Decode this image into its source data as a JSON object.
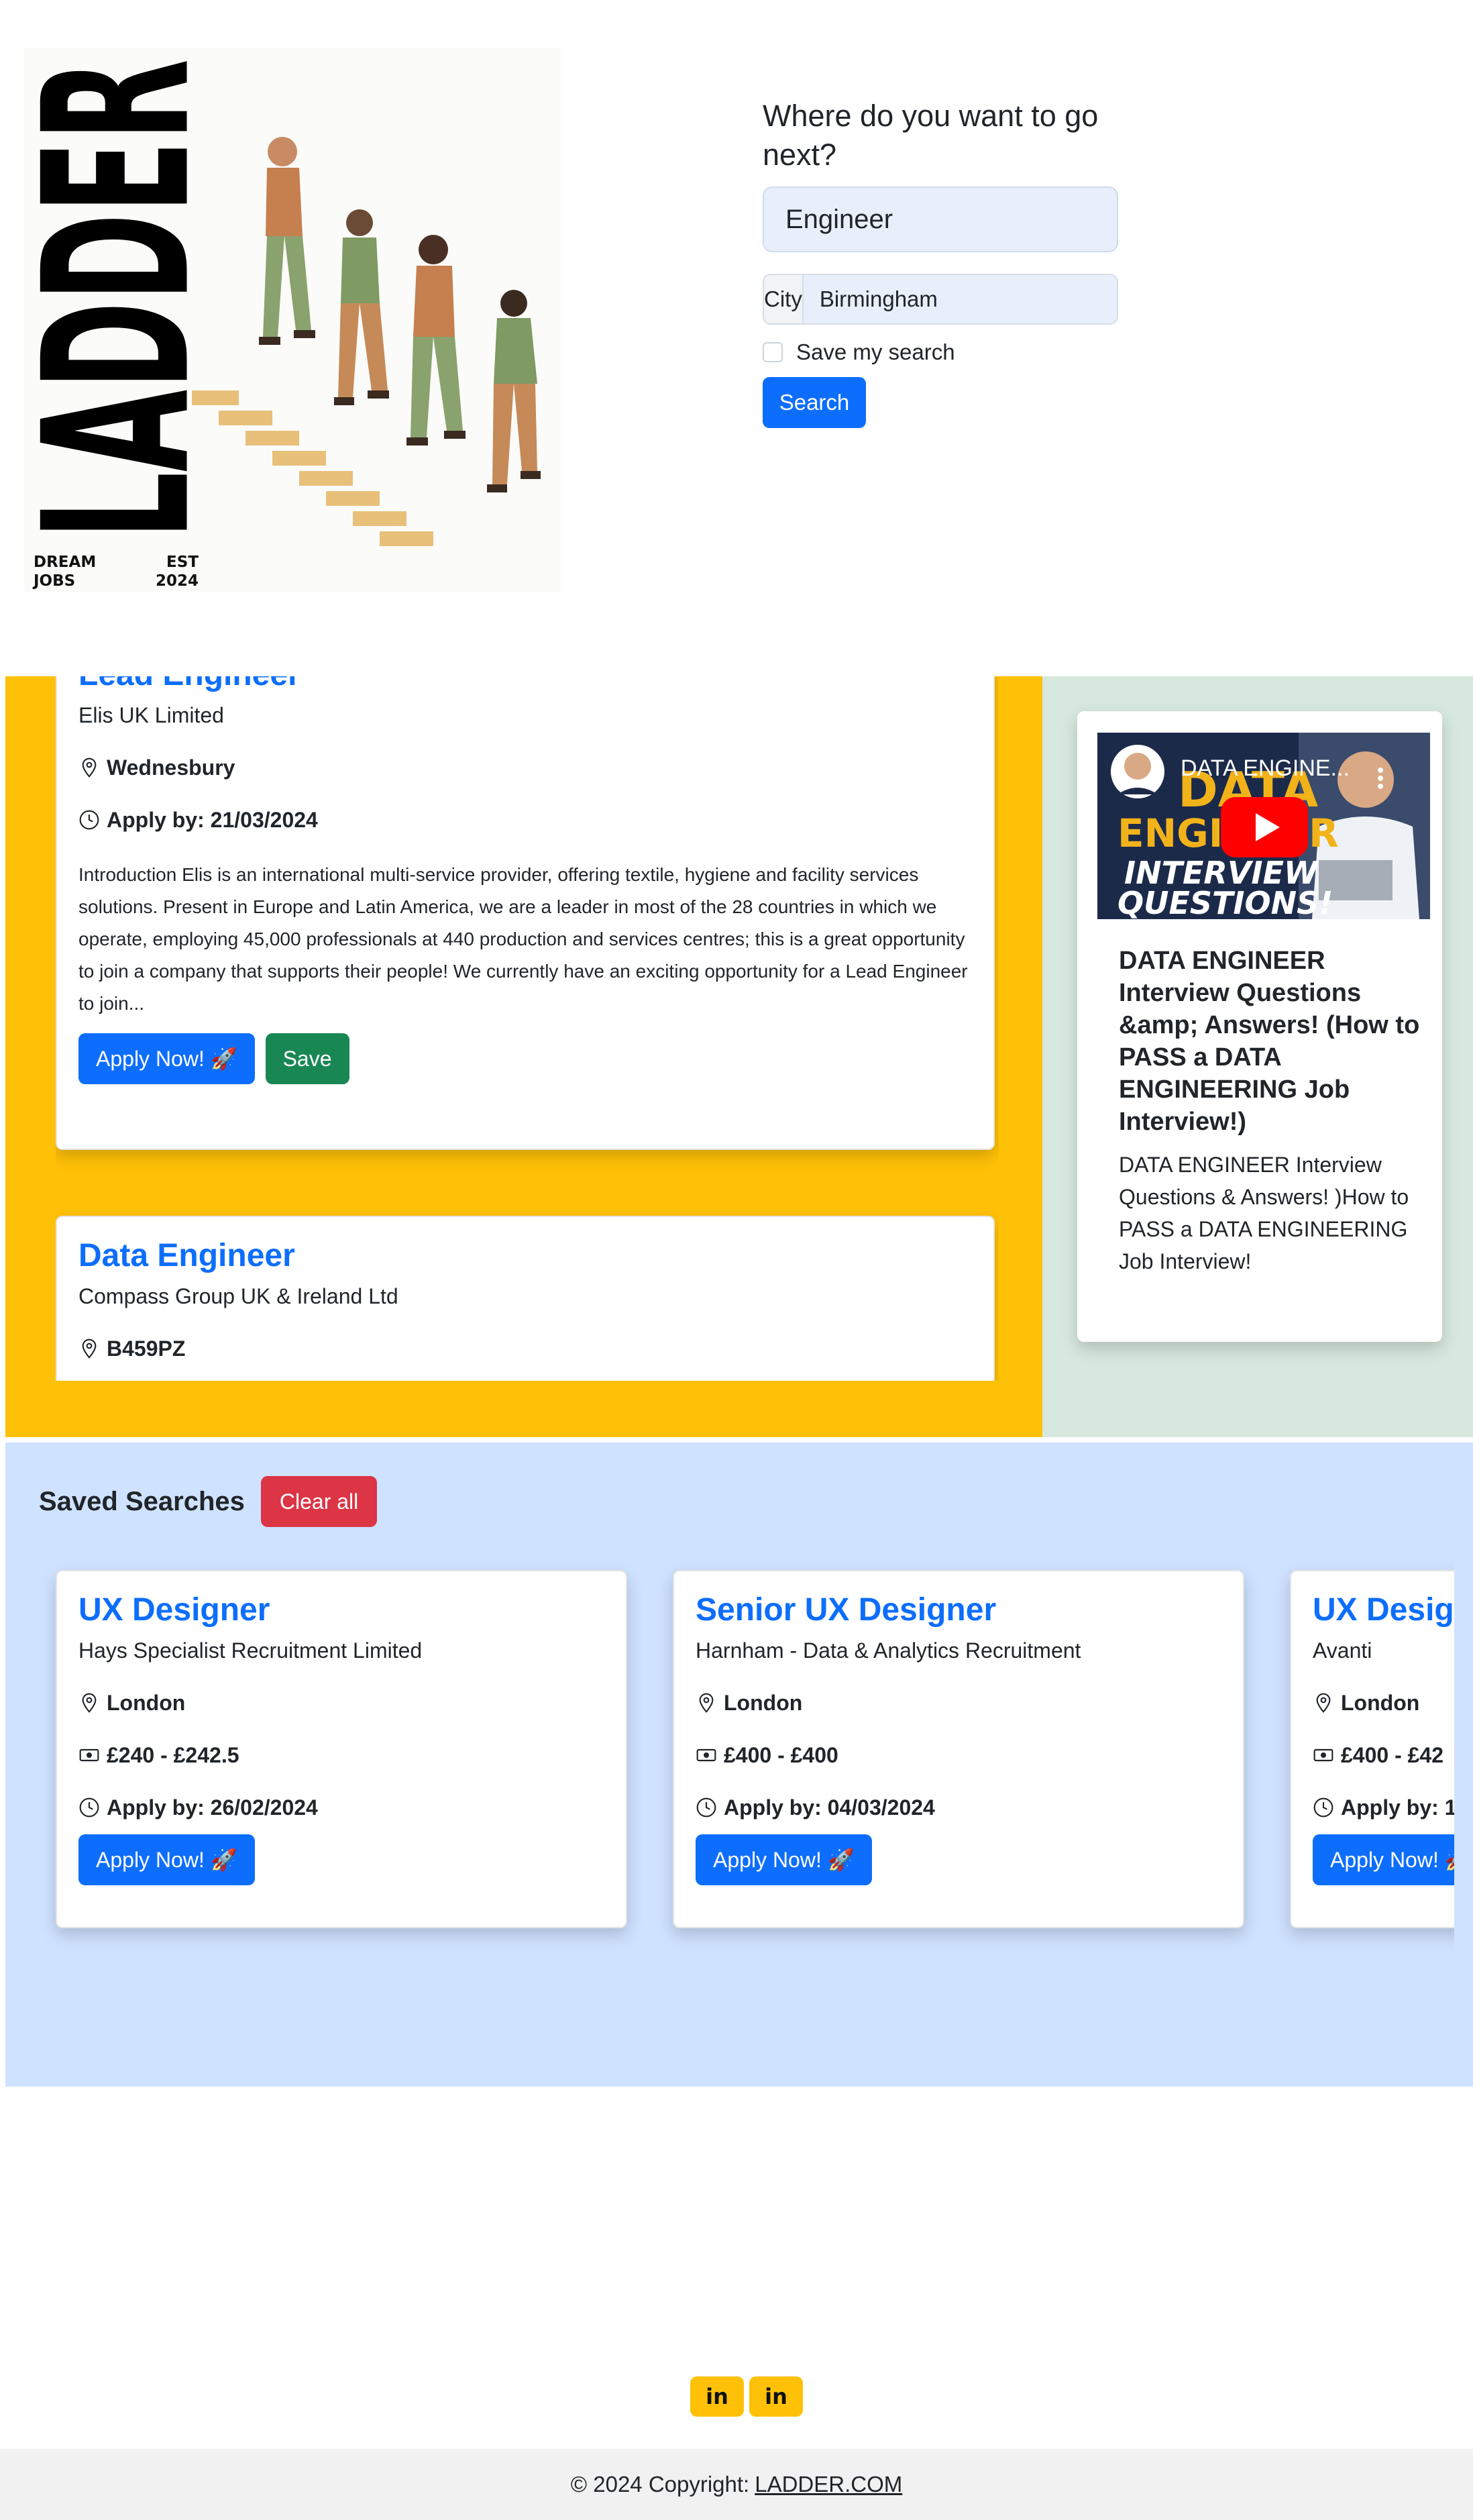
{
  "brand": {
    "logo_text": "LADDER",
    "tagline_left": "DREAM\nJOBS",
    "tagline_right": "EST\n2024"
  },
  "search": {
    "title": "Where do you want to go next?",
    "job_value": "Engineer",
    "city_label": "City",
    "city_value": "Birmingham",
    "save_label": "Save my search",
    "save_checked": false,
    "button_label": "Search"
  },
  "jobs": [
    {
      "title": "Lead Engineer",
      "company": "Elis UK Limited",
      "location": "Wednesbury",
      "apply_by": "Apply by: 21/03/2024",
      "description": "Introduction Elis is an international multi-service provider, offering textile, hygiene and facility services solutions. Present in Europe and Latin America, we are a leader in most of the 28 countries in which we operate, employing 45,000 professionals at 440 production and services centres; this is a great opportunity to join a company that supports their people! We currently have an exciting opportunity for a  Lead Engineer  to join...",
      "apply_label": "Apply Now! 🚀",
      "save_label": "Save"
    },
    {
      "title": "Data Engineer",
      "company": "Compass Group UK & Ireland Ltd",
      "location": "B459PZ"
    }
  ],
  "video": {
    "thumb_title": "DATA ENGINE...",
    "heading": "DATA ENGINEER Interview Questions &amp; Answers! (How to PASS a DATA ENGINEERING Job Interview!)",
    "text": "DATA ENGINEER Interview Questions & Answers! )How to PASS a DATA ENGINEERING Job Interview!",
    "thumb_art_words": [
      "DATA",
      "ENGINEER",
      "INTERVIEW",
      "QUESTIONS!"
    ]
  },
  "saved": {
    "title": "Saved Searches",
    "clear_label": "Clear all",
    "items": [
      {
        "title": "UX Designer",
        "company": "Hays Specialist Recruitment Limited",
        "location": "London",
        "salary": "£240 - £242.5",
        "apply_by": "Apply by: 26/02/2024",
        "apply_label": "Apply Now! 🚀"
      },
      {
        "title": "Senior UX Designer",
        "company": "Harnham - Data & Analytics Recruitment",
        "location": "London",
        "salary": "£400 - £400",
        "apply_by": "Apply by: 04/03/2024",
        "apply_label": "Apply Now! 🚀"
      },
      {
        "title": "UX Designer",
        "company": "Avanti",
        "location": "London",
        "salary": "£400 - £42",
        "apply_by": "Apply by: 1",
        "apply_label": "Apply Now! 🚀"
      }
    ]
  },
  "footer": {
    "social": [
      {
        "icon": "linkedin-icon",
        "label": "in"
      },
      {
        "icon": "linkedin-icon",
        "label": "in"
      }
    ],
    "copyright_prefix": "© 2024 Copyright:",
    "copyright_link": "LADDER.COM"
  },
  "colors": {
    "primary": "#0d6efd",
    "success": "#198754",
    "danger": "#dc3545",
    "warning": "#ffc107",
    "video_bg": "#d7e8de",
    "saved_bg": "#cfe2ff"
  }
}
